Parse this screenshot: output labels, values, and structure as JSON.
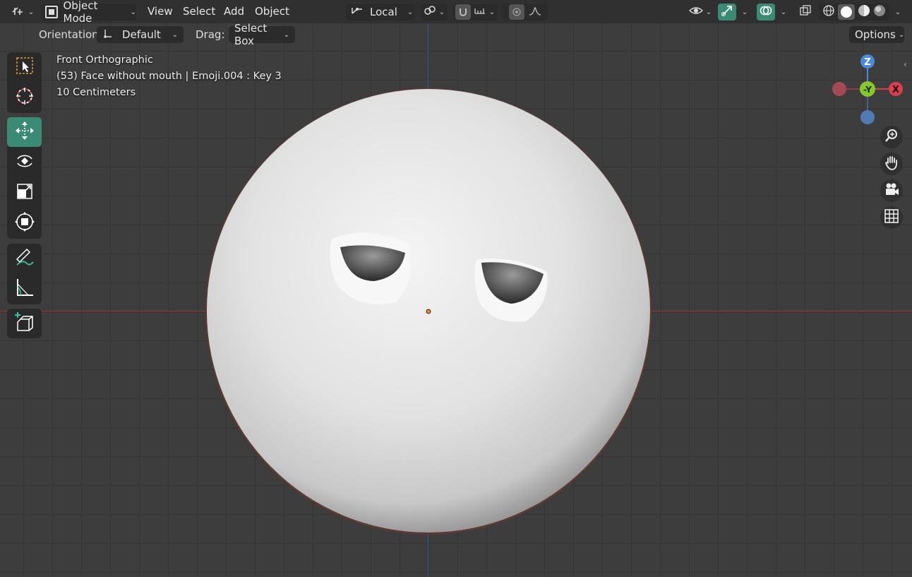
{
  "header": {
    "editor_type_icon": "editor-type-icon",
    "mode": "Object Mode",
    "menus": [
      "View",
      "Select",
      "Add",
      "Object"
    ],
    "transform_orientation": "Local",
    "options_label": "Options"
  },
  "toolbar2": {
    "orientation_label": "Orientation:",
    "orientation_value": "Default",
    "drag_label": "Drag:",
    "drag_value": "Select Box"
  },
  "overlay": {
    "view_name": "Front Orthographic",
    "object_info": "(53) Face without mouth | Emoji.004 : Key 3",
    "scale": "10 Centimeters"
  },
  "gizmo": {
    "z": "Z",
    "y": "-Y",
    "x": "X"
  },
  "tools": [
    "select-box-icon",
    "cursor-icon",
    "move-icon",
    "rotate-icon",
    "scale-icon",
    "transform-icon",
    "annotate-icon",
    "measure-icon",
    "add-cube-icon"
  ],
  "nav": [
    "zoom-icon",
    "hand-icon",
    "camera-icon",
    "grid-icon"
  ],
  "colors": {
    "accent": "#3b8a74",
    "x_axis": "#d6404f",
    "y_axis": "#86c72d",
    "z_axis": "#4a8ad9",
    "background": "#3d3d3d"
  }
}
